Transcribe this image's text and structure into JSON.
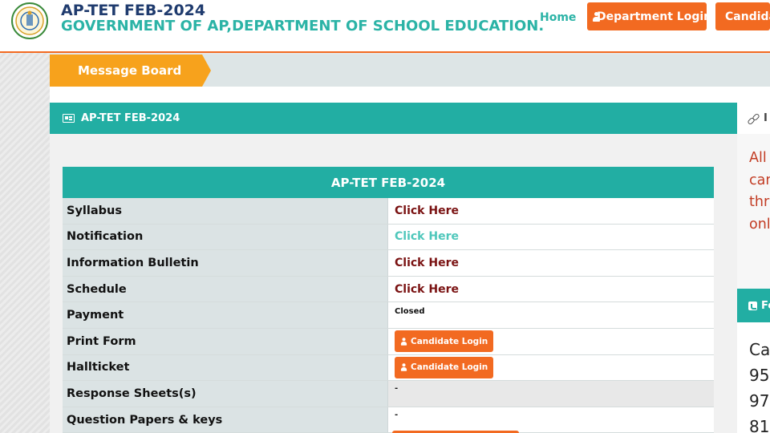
{
  "header": {
    "title": "AP-TET FEB-2024",
    "subtitle": "GOVERNMENT OF AP,DEPARTMENT OF SCHOOL EDUCATION.",
    "nav": {
      "home": "Home",
      "department_login": "Department Login",
      "candidate_login": "Candidate Login"
    }
  },
  "message_board": {
    "label": "Message Board"
  },
  "panel": {
    "heading": "AP-TET FEB-2024",
    "table": {
      "title": "AP-TET FEB-2024",
      "rows": [
        {
          "label": "Syllabus",
          "value": "Click Here"
        },
        {
          "label": "Notification",
          "value": "Click Here"
        },
        {
          "label": "Information Bulletin",
          "value": "Click Here"
        },
        {
          "label": "Schedule",
          "value": "Click Here"
        },
        {
          "label": "Payment",
          "value": "Closed"
        },
        {
          "label": "Print Form",
          "value": "Candidate Login"
        },
        {
          "label": "Hallticket",
          "value": "Candidate Login"
        },
        {
          "label": "Response Sheets(s)",
          "value": "-"
        },
        {
          "label": "Question Papers & keys",
          "value": "-"
        }
      ]
    }
  },
  "sidebar": {
    "heading1": "I",
    "body1_lines": [
      "All",
      "can",
      "thr",
      "onl"
    ],
    "heading2": "Fo",
    "body2_lines": [
      "Ca",
      "95",
      "97",
      "81"
    ]
  },
  "colors": {
    "accent_orange": "#f26a21",
    "teal": "#22aea3",
    "message_orange": "#f7a21c",
    "link_dark": "#7a1212",
    "link_teal": "#4fc7bb"
  }
}
